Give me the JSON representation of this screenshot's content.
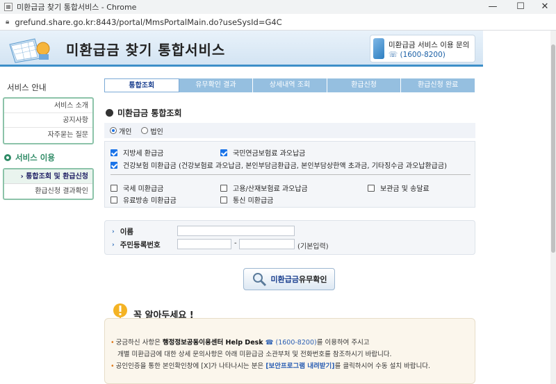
{
  "browser": {
    "tab_title": "미환급금 찾기 통합서비스 - Chrome",
    "url": "grefund.share.go.kr:8443/portal/MmsPortalMain.do?useSysId=G4C",
    "controls": {
      "minimize": "—",
      "maximize": "☐",
      "close": "✕"
    }
  },
  "header": {
    "site_title": "미환급금 찾기 통합서비스",
    "help_line1": "미환급금 서비스 이용 문의",
    "help_line2": "☏ (1600-8200)"
  },
  "sidebar": {
    "guide_title": "서비스 안내",
    "guide_items": [
      "서비스 소개",
      "공지사항",
      "자주묻는 질문"
    ],
    "use_title": "서비스 이용",
    "use_items": [
      "› 통합조회 및 환급신청",
      "환급신청 결과확인"
    ],
    "active_index": 0
  },
  "steps": [
    "통합조회",
    "유무확인 결과",
    "상세내역 조회",
    "환급신청",
    "환급신청 완료"
  ],
  "active_step": 0,
  "section_title": "미환급금 통합조회",
  "person_type": {
    "options": [
      "개인",
      "법인"
    ],
    "selected": "개인"
  },
  "checkboxes": {
    "group1": [
      {
        "label": "지방세 환급금",
        "checked": true
      },
      {
        "label": "국민연금보험료 과오납금",
        "checked": true
      },
      {
        "label": "건강보험 미환급금 (건강보험료 과오납금, 본인부담금환급금, 본인부담상한액 초과금, 기타징수금 과오납환급금)",
        "checked": true
      }
    ],
    "group2": [
      {
        "label": "국세 미환급금",
        "checked": false
      },
      {
        "label": "고용/산재보험료 과오납금",
        "checked": false
      },
      {
        "label": "보관금 및 송달료",
        "checked": false
      },
      {
        "label": "유료방송 미환급금",
        "checked": false
      },
      {
        "label": "통신 미환급금",
        "checked": false
      }
    ]
  },
  "form": {
    "name_label": "이름",
    "id_label": "주민등록번호",
    "name_value": "",
    "id_front": "",
    "id_back": "",
    "separator": "-",
    "id_note": "(기본입력)"
  },
  "check_button": {
    "label_part1": "미환급금",
    "label_part2": " 유무확인"
  },
  "must_know": "꼭 알아두세요 !",
  "info": {
    "line1_a": "궁금하신 사항은 ",
    "line1_b": "행정정보공동이용센터 Help Desk",
    "line1_c": " ☎ (1600-8200)",
    "line1_d": "를 이용하여 주시고",
    "line2": "개별 미환급금에 대한 상세 문의사항은 아래 미환급금 소관부처 및 전화번호를 참조하시기 바랍니다.",
    "line3_a": "공인인증을 통한 본인확인창에 [X]가 나타나시는 분은 ",
    "line3_b": "[보안프로그램 내려받기]",
    "line3_c": "를 클릭하시어 수동 설치 바랍니다."
  }
}
